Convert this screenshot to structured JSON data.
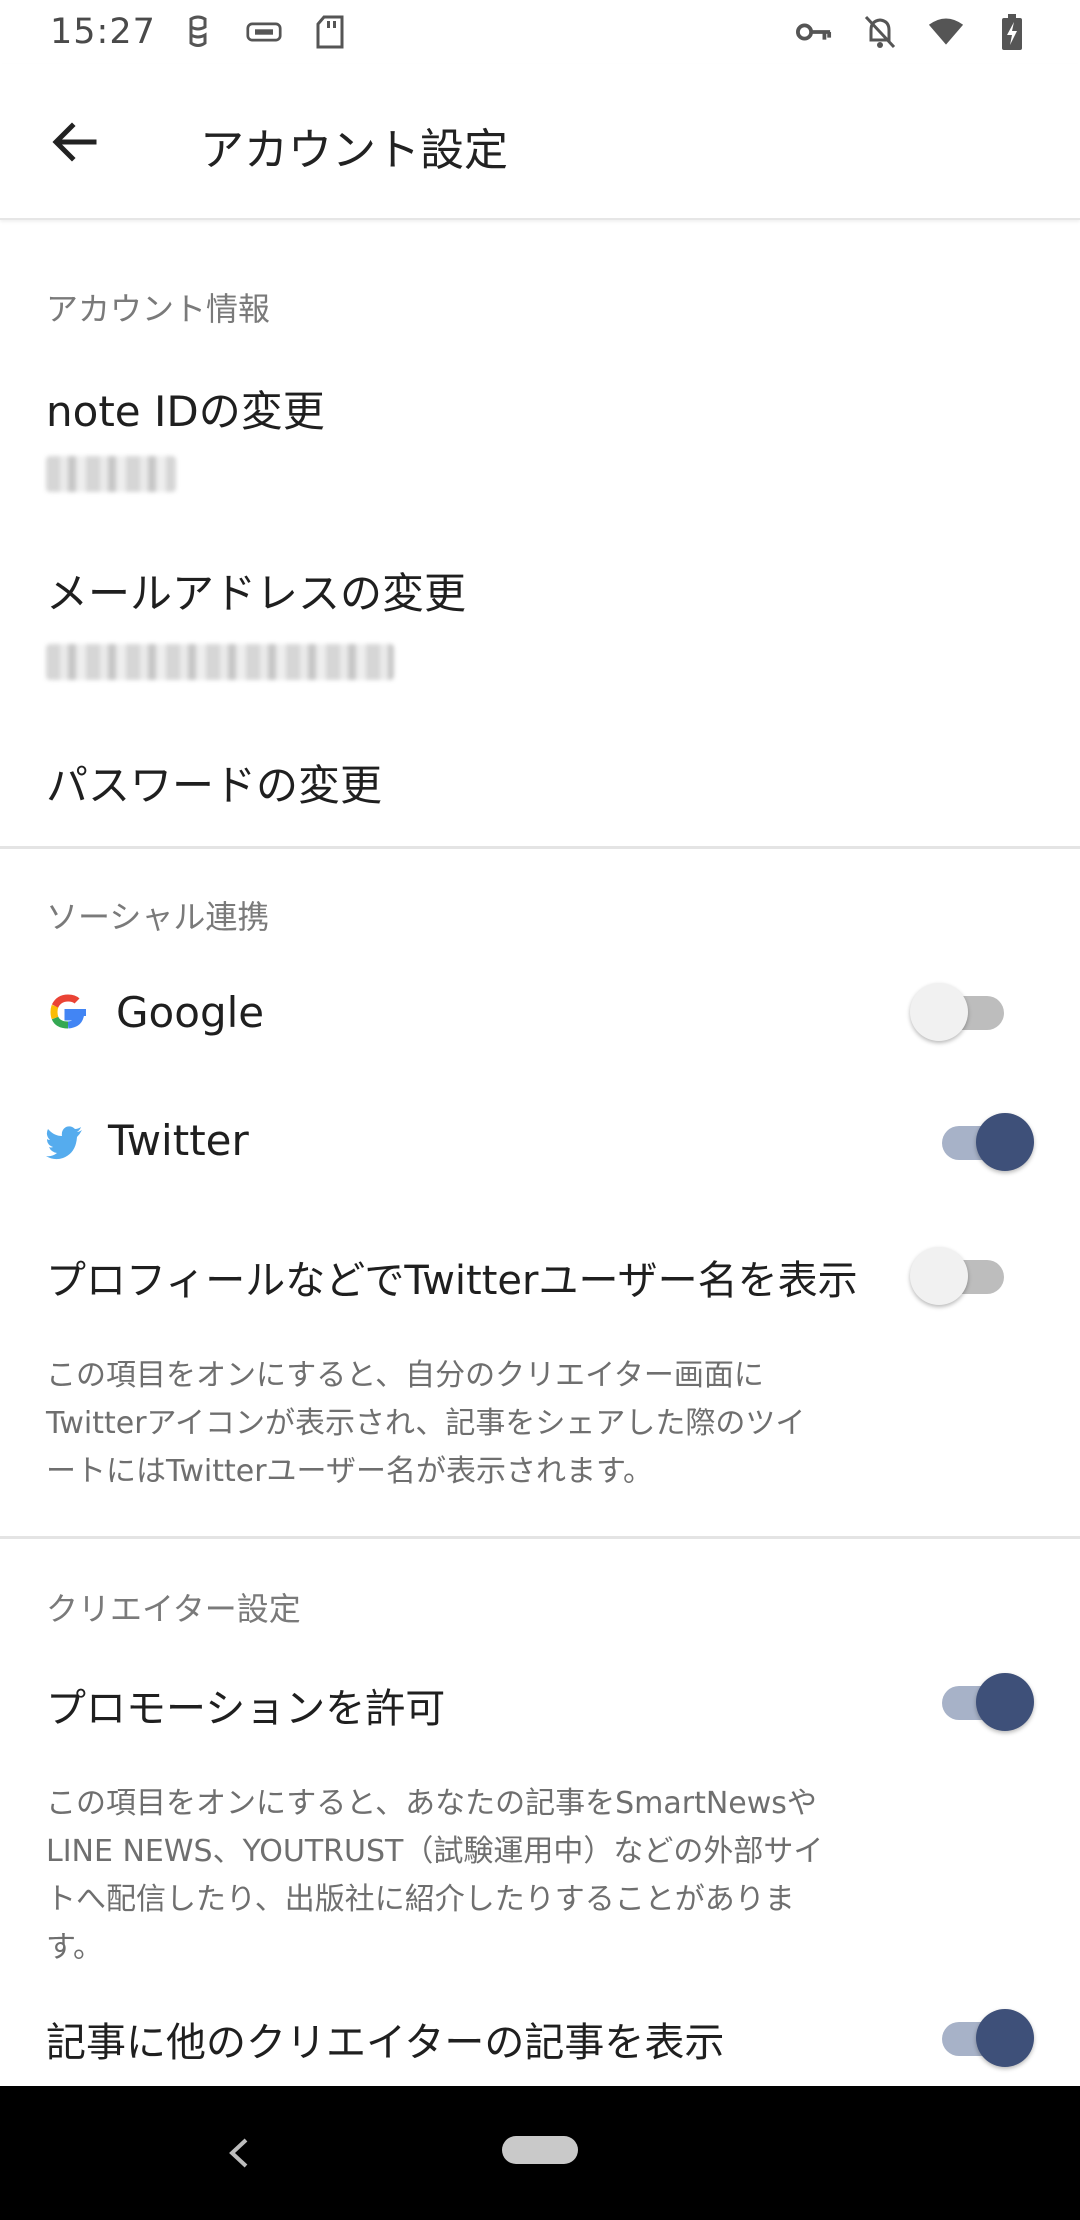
{
  "status_bar": {
    "time": "15:27",
    "left_icons": [
      "accessibility-icon",
      "keyboard-icon",
      "sd-card-icon"
    ],
    "right_icons": [
      "vpn-key-icon",
      "notifications-off-icon",
      "wifi-icon",
      "battery-charging-icon"
    ]
  },
  "app_bar": {
    "title": "アカウント設定",
    "back_icon": "arrow-back-icon"
  },
  "account_info": {
    "header": "アカウント情報",
    "note_id_title": "note IDの変更",
    "email_title": "メールアドレスの変更",
    "password_title": "パスワードの変更"
  },
  "social": {
    "header": "ソーシャル連携",
    "google": {
      "label": "Google",
      "on": false
    },
    "twitter": {
      "label": "Twitter",
      "on": true
    },
    "show_twitter_name": {
      "label": "プロフィールなどでTwitterユーザー名を表示",
      "on": false,
      "desc_lines": [
        "この項目をオンにすると、自分のクリエイター画面に",
        "Twitterアイコンが表示され、記事をシェアした際のツイ",
        "ートにはTwitterユーザー名が表示されます。"
      ]
    }
  },
  "creator": {
    "header": "クリエイター設定",
    "promotion": {
      "label": "プロモーションを許可",
      "on": true,
      "desc_lines": [
        "この項目をオンにすると、あなたの記事をSmartNewsや",
        "LINE NEWS、YOUTRUST（試験運用中）などの外部サイ",
        "トへ配信したり、出版社に紹介したりすることがありま",
        "す。"
      ]
    },
    "other_creators": {
      "label": "記事に他のクリエイターの記事を表示",
      "on": true
    }
  },
  "colors": {
    "toggle_on_thumb": "#3e5079",
    "toggle_on_track": "#a7b2c8",
    "twitter_blue": "#55acee"
  }
}
